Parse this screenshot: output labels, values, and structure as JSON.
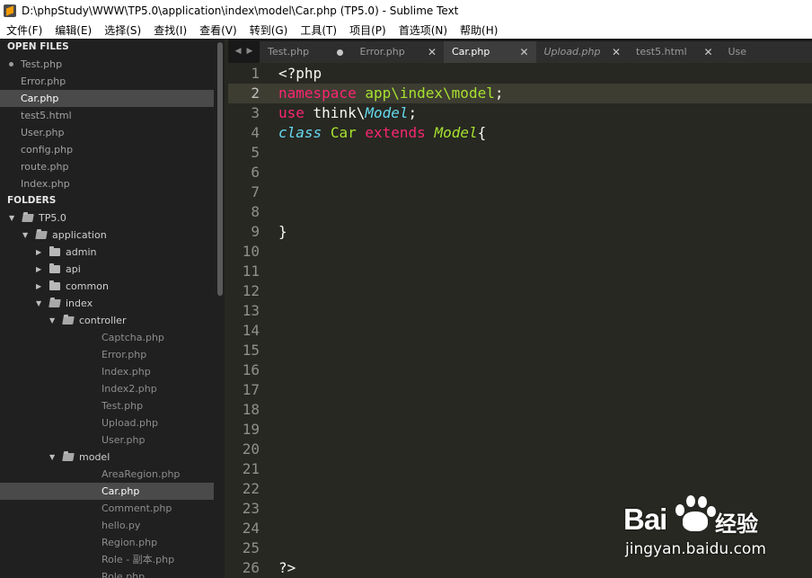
{
  "window": {
    "title": "D:\\phpStudy\\WWW\\TP5.0\\application\\index\\model\\Car.php (TP5.0) - Sublime Text"
  },
  "menu": [
    "文件(F)",
    "编辑(E)",
    "选择(S)",
    "查找(I)",
    "查看(V)",
    "转到(G)",
    "工具(T)",
    "项目(P)",
    "首选项(N)",
    "帮助(H)"
  ],
  "sidebar": {
    "open_files_header": "OPEN FILES",
    "open_files": [
      {
        "name": "Test.php",
        "dirty": true
      },
      {
        "name": "Error.php"
      },
      {
        "name": "Car.php",
        "selected": true
      },
      {
        "name": "test5.html"
      },
      {
        "name": "User.php"
      },
      {
        "name": "config.php"
      },
      {
        "name": "route.php"
      },
      {
        "name": "Index.php"
      }
    ],
    "folders_header": "FOLDERS",
    "tree": [
      {
        "label": "TP5.0",
        "type": "folder",
        "open": true,
        "depth": 0
      },
      {
        "label": "application",
        "type": "folder",
        "open": true,
        "depth": 1
      },
      {
        "label": "admin",
        "type": "folder",
        "open": false,
        "depth": 2
      },
      {
        "label": "api",
        "type": "folder",
        "open": false,
        "depth": 2
      },
      {
        "label": "common",
        "type": "folder",
        "open": false,
        "depth": 2
      },
      {
        "label": "index",
        "type": "folder",
        "open": true,
        "depth": 2
      },
      {
        "label": "controller",
        "type": "folder",
        "open": true,
        "depth": 3
      },
      {
        "label": "Captcha.php",
        "type": "file",
        "depth": 4
      },
      {
        "label": "Error.php",
        "type": "file",
        "depth": 4
      },
      {
        "label": "Index.php",
        "type": "file",
        "depth": 4
      },
      {
        "label": "Index2.php",
        "type": "file",
        "depth": 4
      },
      {
        "label": "Test.php",
        "type": "file",
        "depth": 4
      },
      {
        "label": "Upload.php",
        "type": "file",
        "depth": 4
      },
      {
        "label": "User.php",
        "type": "file",
        "depth": 4
      },
      {
        "label": "model",
        "type": "folder",
        "open": true,
        "depth": 3
      },
      {
        "label": "AreaRegion.php",
        "type": "file",
        "depth": 4
      },
      {
        "label": "Car.php",
        "type": "file",
        "depth": 4,
        "selected": true
      },
      {
        "label": "Comment.php",
        "type": "file",
        "depth": 4
      },
      {
        "label": "hello.py",
        "type": "file",
        "depth": 4
      },
      {
        "label": "Region.php",
        "type": "file",
        "depth": 4
      },
      {
        "label": "Role - 副本.php",
        "type": "file",
        "depth": 4
      },
      {
        "label": "Role.php",
        "type": "file",
        "depth": 4
      }
    ]
  },
  "tabs": [
    {
      "label": "Test.php",
      "dirty": true
    },
    {
      "label": "Error.php"
    },
    {
      "label": "Car.php",
      "active": true
    },
    {
      "label": "Upload.php",
      "italic": true
    },
    {
      "label": "test5.html"
    },
    {
      "label": "Use"
    }
  ],
  "editor": {
    "current_line": 2,
    "lines": [
      {
        "n": "1",
        "tokens": [
          [
            "",
            "<?php"
          ]
        ]
      },
      {
        "n": "2",
        "tokens": [
          [
            "kw",
            "namespace"
          ],
          [
            "",
            " "
          ],
          [
            "cls",
            "app\\index\\model"
          ],
          [
            "",
            ";"
          ]
        ]
      },
      {
        "n": "3",
        "tokens": [
          [
            "kw",
            "use"
          ],
          [
            "",
            " think\\"
          ],
          [
            "mcls",
            "Model"
          ],
          [
            "",
            ";"
          ]
        ]
      },
      {
        "n": "4",
        "tokens": [
          [
            "kw2",
            "class"
          ],
          [
            "",
            " "
          ],
          [
            "cls",
            "Car"
          ],
          [
            "",
            " "
          ],
          [
            "kw",
            "extends"
          ],
          [
            "",
            " "
          ],
          [
            "sup",
            "Model"
          ],
          [
            "",
            "{"
          ]
        ]
      },
      {
        "n": "5",
        "tokens": []
      },
      {
        "n": "6",
        "tokens": []
      },
      {
        "n": "7",
        "tokens": []
      },
      {
        "n": "8",
        "tokens": []
      },
      {
        "n": "9",
        "tokens": [
          [
            "",
            "}"
          ]
        ]
      },
      {
        "n": "10",
        "tokens": []
      },
      {
        "n": "11",
        "tokens": []
      },
      {
        "n": "12",
        "tokens": []
      },
      {
        "n": "13",
        "tokens": []
      },
      {
        "n": "14",
        "tokens": []
      },
      {
        "n": "15",
        "tokens": []
      },
      {
        "n": "16",
        "tokens": []
      },
      {
        "n": "17",
        "tokens": []
      },
      {
        "n": "18",
        "tokens": []
      },
      {
        "n": "19",
        "tokens": []
      },
      {
        "n": "20",
        "tokens": []
      },
      {
        "n": "21",
        "tokens": []
      },
      {
        "n": "22",
        "tokens": []
      },
      {
        "n": "23",
        "tokens": []
      },
      {
        "n": "24",
        "tokens": []
      },
      {
        "n": "25",
        "tokens": []
      },
      {
        "n": "26",
        "tokens": [
          [
            "",
            "?>"
          ]
        ]
      }
    ]
  },
  "watermark": {
    "brand": "Bai",
    "brand_suffix": "经验",
    "url": "jingyan.baidu.com"
  },
  "colors": {
    "background": "#272822",
    "keyword": "#f92672",
    "class": "#a6e22e",
    "storage": "#66d9ef",
    "sidebar": "#202020"
  }
}
